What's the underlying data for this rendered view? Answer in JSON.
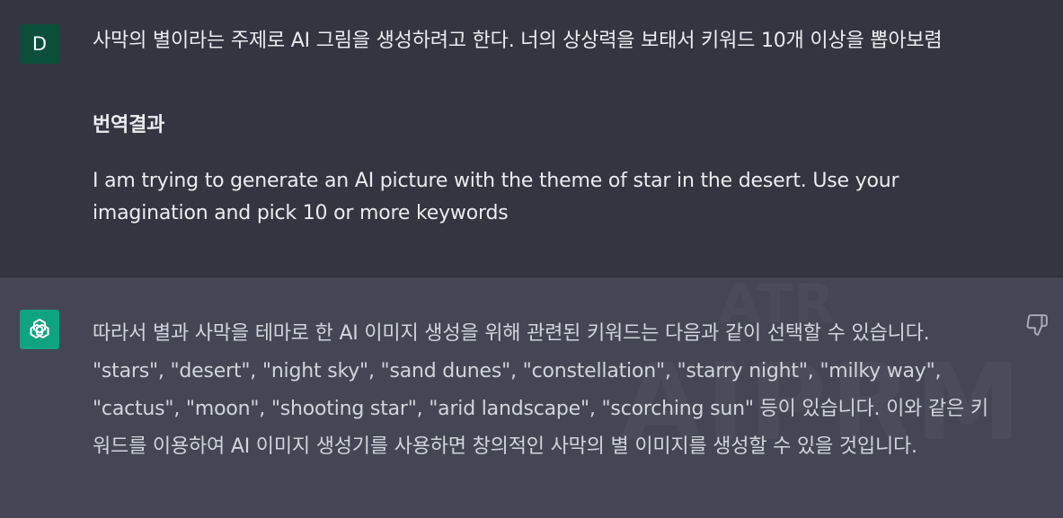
{
  "user_message": {
    "avatar_letter": "D",
    "avatar_color": "#0b4f3a",
    "text": "사막의 별이라는 주제로 AI 그림을 생성하려고 한다. 너의 상상력을 보태서 키워드 10개 이상을 뽑아보렴",
    "translation_heading": "번역결과",
    "translation_text": "I am trying to generate an AI picture with the theme of star in the desert. Use your imagination and pick 10 or more keywords"
  },
  "assistant_message": {
    "avatar_icon": "openai-logo-icon",
    "avatar_color": "#10a37f",
    "text": "따라서 별과 사막을 테마로 한 AI 이미지 생성을 위해 관련된 키워드는 다음과 같이 선택할 수 있습니다. \"stars\", \"desert\", \"night sky\", \"sand dunes\", \"constellation\", \"starry night\", \"milky way\", \"cactus\", \"moon\", \"shooting star\", \"arid landscape\", \"scorching sun\" 등이 있습니다. 이와 같은 키워드를 이용하여 AI 이미지 생성기를 사용하면 창의적인 사막의 별 이미지를 생성할 수 있을 것입니다.",
    "watermark_top": "ATR",
    "watermark": "AIPRM",
    "feedback_icon": "thumbs-down-icon"
  }
}
